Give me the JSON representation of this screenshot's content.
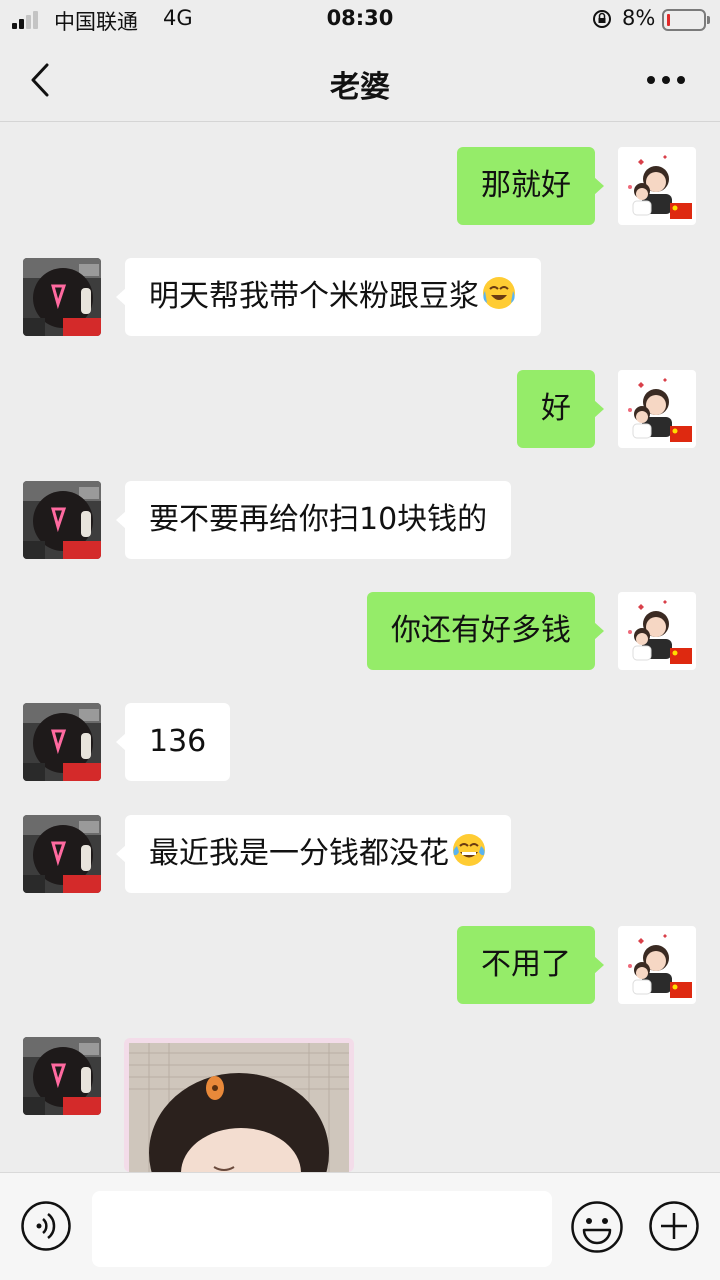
{
  "status_bar": {
    "carrier": "中国联通",
    "network": "4G",
    "time": "08:30",
    "battery": "8%",
    "battery_level": 0.08
  },
  "header": {
    "title": "老婆",
    "back_icon": "chevron-left-icon",
    "more_icon": "more-dots-icon"
  },
  "messages": [
    {
      "from": "me",
      "text": "那就好"
    },
    {
      "from": "other",
      "text": "明天帮我带个米粉跟豆浆",
      "emoji": "crying-laughing-emoji"
    },
    {
      "from": "me",
      "text": "好"
    },
    {
      "from": "other",
      "text": "要不要再给你扫10块钱的"
    },
    {
      "from": "me",
      "text": "你还有好多钱"
    },
    {
      "from": "other",
      "text": "136"
    },
    {
      "from": "other",
      "text": "最近我是一分钱都没花",
      "emoji": "tears-of-joy-emoji"
    },
    {
      "from": "me",
      "text": "不用了"
    },
    {
      "from": "other",
      "type": "image"
    }
  ],
  "input_bar": {
    "voice_icon": "voice-icon",
    "emoji_icon": "emoji-icon",
    "plus_icon": "plus-icon",
    "input_value": ""
  },
  "colors": {
    "outgoing_bubble": "#95ec69",
    "incoming_bubble": "#ffffff",
    "background": "#ededed"
  }
}
